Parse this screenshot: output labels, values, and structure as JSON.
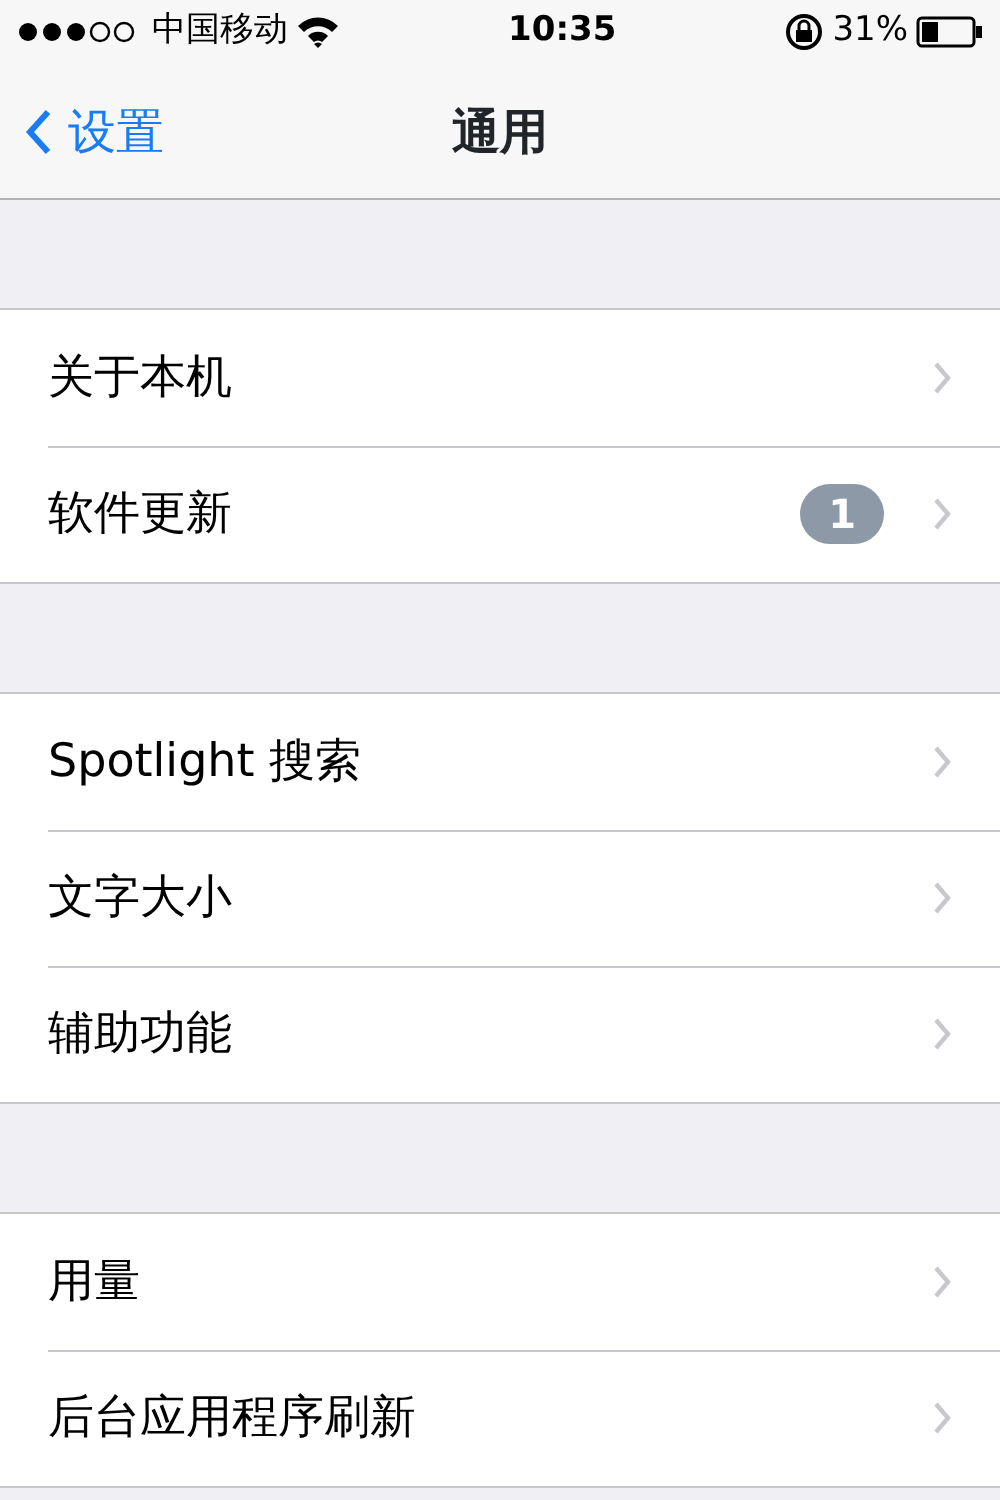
{
  "status_bar": {
    "carrier": "中国移动",
    "time": "10:35",
    "battery": "31%"
  },
  "nav": {
    "back": "设置",
    "title": "通用"
  },
  "groups": [
    {
      "items": [
        {
          "label": "关于本机"
        },
        {
          "label": "软件更新",
          "badge": "1"
        }
      ]
    },
    {
      "items": [
        {
          "label": "Spotlight 搜索"
        },
        {
          "label": "文字大小"
        },
        {
          "label": "辅助功能"
        }
      ]
    },
    {
      "items": [
        {
          "label": "用量"
        },
        {
          "label": "后台应用程序刷新"
        }
      ]
    }
  ]
}
